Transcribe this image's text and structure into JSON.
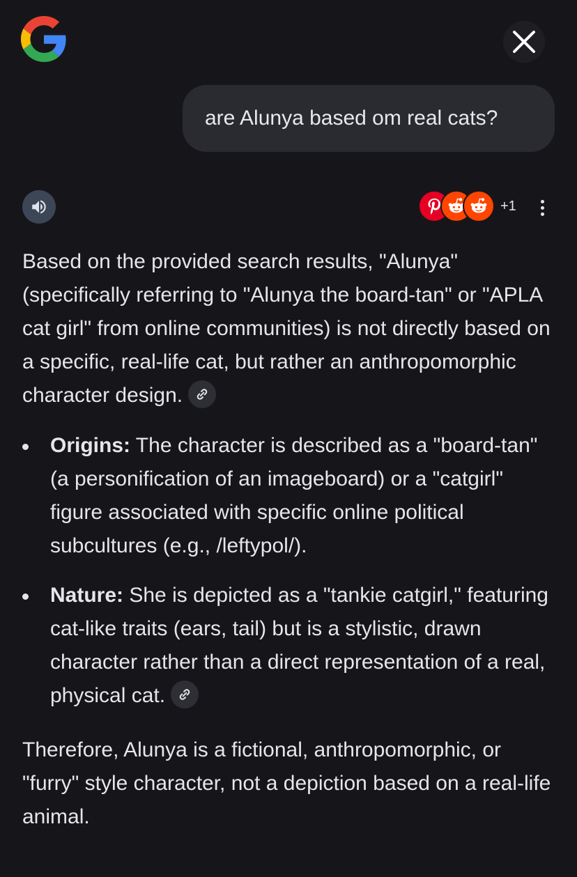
{
  "header": {
    "logo_icon": "google-g-logo",
    "close_icon": "close-icon"
  },
  "query": {
    "text": "are Alunya based om real cats?"
  },
  "toolbar": {
    "speaker_icon": "speaker-icon",
    "sources": [
      {
        "icon": "pinterest-icon",
        "color": "#e60023"
      },
      {
        "icon": "reddit-icon",
        "color": "#ff4500"
      },
      {
        "icon": "reddit-icon",
        "color": "#ff4500"
      }
    ],
    "sources_more": "+1",
    "more_icon": "more-vertical-icon"
  },
  "answer": {
    "intro": "Based on the provided search results, \"Alunya\" (specifically referring to \"Alunya the board-tan\" or \"APLA cat girl\" from online communities) is not directly based on a specific, real-life cat, but rather an anthropomorphic character design.",
    "bullets": [
      {
        "label": "Origins:",
        "text": " The character is described as a \"board-tan\" (a personification of an imageboard) or a \"catgirl\" figure associated with specific online political subcultures (e.g., /leftypol/)."
      },
      {
        "label": "Nature:",
        "text": " She is depicted as a \"tankie catgirl,\" featuring cat-like traits (ears, tail) but is a stylistic, drawn character rather than a direct representation of a real, physical cat."
      }
    ],
    "conclusion": "Therefore, Alunya is a fictional, anthropomorphic, or \"furry\" style character, not a depiction based on a real-life animal.",
    "link_icon": "link-icon"
  },
  "colors": {
    "background": "#16161a",
    "bubble": "#2a2b30",
    "speaker_button": "#3d4657",
    "text": "#e6e6e9"
  }
}
